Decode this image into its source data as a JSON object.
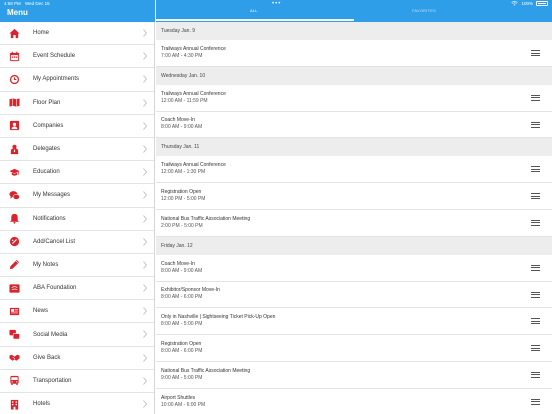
{
  "status_bar": {
    "time": "4:58 PM",
    "date": "Wed Dec 15",
    "battery": "100%"
  },
  "menu": {
    "title": "Menu",
    "items": [
      {
        "label": "Home",
        "icon": "home-icon"
      },
      {
        "label": "Event Schedule",
        "icon": "calendar-icon"
      },
      {
        "label": "My Appointments",
        "icon": "clock-icon"
      },
      {
        "label": "Floor Plan",
        "icon": "map-icon"
      },
      {
        "label": "Companies",
        "icon": "building-badge-icon"
      },
      {
        "label": "Delegates",
        "icon": "person-icon"
      },
      {
        "label": "Education",
        "icon": "graduation-cap-icon"
      },
      {
        "label": "My Messages",
        "icon": "chat-bubbles-icon"
      },
      {
        "label": "Notifications",
        "icon": "bell-icon"
      },
      {
        "label": "Add/Cancel List",
        "icon": "add-cancel-icon"
      },
      {
        "label": "My Notes",
        "icon": "pencil-icon"
      },
      {
        "label": "ABA Foundation",
        "icon": "foundation-icon"
      },
      {
        "label": "News",
        "icon": "news-icon"
      },
      {
        "label": "Social Media",
        "icon": "social-icon"
      },
      {
        "label": "Give Back",
        "icon": "handshake-icon"
      },
      {
        "label": "Transportation",
        "icon": "bus-icon"
      },
      {
        "label": "Hotels",
        "icon": "hotel-icon"
      }
    ]
  },
  "tabs": {
    "all": "ALL",
    "favorites": "FAVORITES"
  },
  "schedule": [
    {
      "day": "Tuesday Jan. 9",
      "events": [
        {
          "title": "Trailways Annual Conference",
          "time": "7:00 AM - 4:30 PM"
        }
      ]
    },
    {
      "day": "Wednesday Jan. 10",
      "events": [
        {
          "title": "Trailways Annual Conference",
          "time": "12:00 AM - 11:59 PM"
        },
        {
          "title": "Coach Move-In",
          "time": "8:00 AM - 9:00 AM"
        }
      ]
    },
    {
      "day": "Thursday Jan. 11",
      "events": [
        {
          "title": "Trailways Annual Conference",
          "time": "12:00 AM - 1:30 PM"
        },
        {
          "title": "Registration Open",
          "time": "12:00 PM - 5:00 PM"
        },
        {
          "title": "National Bus Traffic Association Meeting",
          "time": "2:00 PM - 5:00 PM"
        }
      ]
    },
    {
      "day": "Friday Jan. 12",
      "events": [
        {
          "title": "Coach Move-In",
          "time": "8:00 AM - 9:00 AM"
        },
        {
          "title": "Exhibitor/Sponsor Move-In",
          "time": "8:00 AM - 6:00 PM"
        },
        {
          "title": "Only in Nashville | Sightseeing Ticket Pick-Up Open",
          "time": "8:00 AM - 5:00 PM"
        },
        {
          "title": "Registration Open",
          "time": "8:00 AM - 6:00 PM"
        },
        {
          "title": "National Bus Traffic Association Meeting",
          "time": "9:00 AM - 5:00 PM"
        },
        {
          "title": "Airport Shuttles",
          "time": "10:00 AM - 6:00 PM"
        }
      ]
    }
  ],
  "colors": {
    "accent_blue": "#2e9ee8",
    "icon_red": "#d9232d"
  }
}
